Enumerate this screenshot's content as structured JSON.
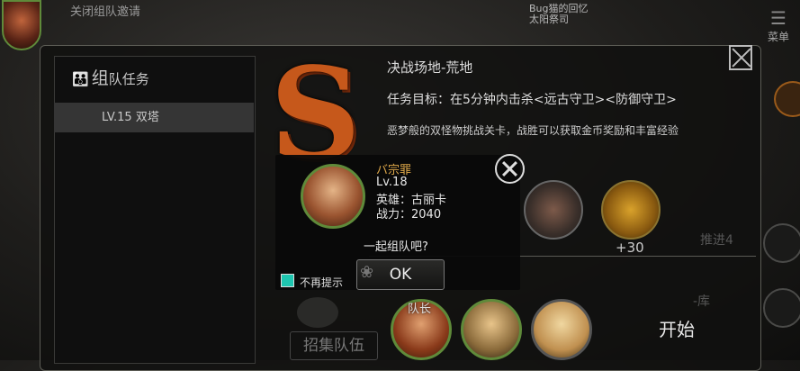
{
  "top": {
    "status_text": "关闭组队邀请",
    "player_name_line1": "Bug猫的回忆",
    "player_name_line2": "太阳祭司",
    "menu_label": "菜单",
    "menu_icon": "hamburger-icon"
  },
  "left_panel": {
    "header_prefix": "组",
    "header_suffix": "队任务",
    "header_icon": "team-people-icon",
    "items": [
      {
        "label": "LV.15 双塔"
      }
    ]
  },
  "quest": {
    "rank": "S",
    "title": "决战场地-荒地",
    "goal": "任务目标：在5分钟内击杀<远古守卫><防御守卫>",
    "description": "恶梦般的双怪物挑战关卡，战胜可以获取金币奖励和丰富经验",
    "reward_gold_count": "+30",
    "faded_label_1": "推进4",
    "faded_label_2": "-库"
  },
  "team": {
    "recruit_label": "招集队伍",
    "leader_label": "队长",
    "start_label": "开始"
  },
  "popup": {
    "name": "バ宗罪",
    "level": "Lv.18",
    "hero": "英雄：古丽卡",
    "power": "战力：2040",
    "question": "一起组队吧?",
    "ok_label": "OK",
    "dont_remind_label": "不再提示",
    "dont_remind_checked": true,
    "checkbox_color": "#1ec6b0"
  }
}
